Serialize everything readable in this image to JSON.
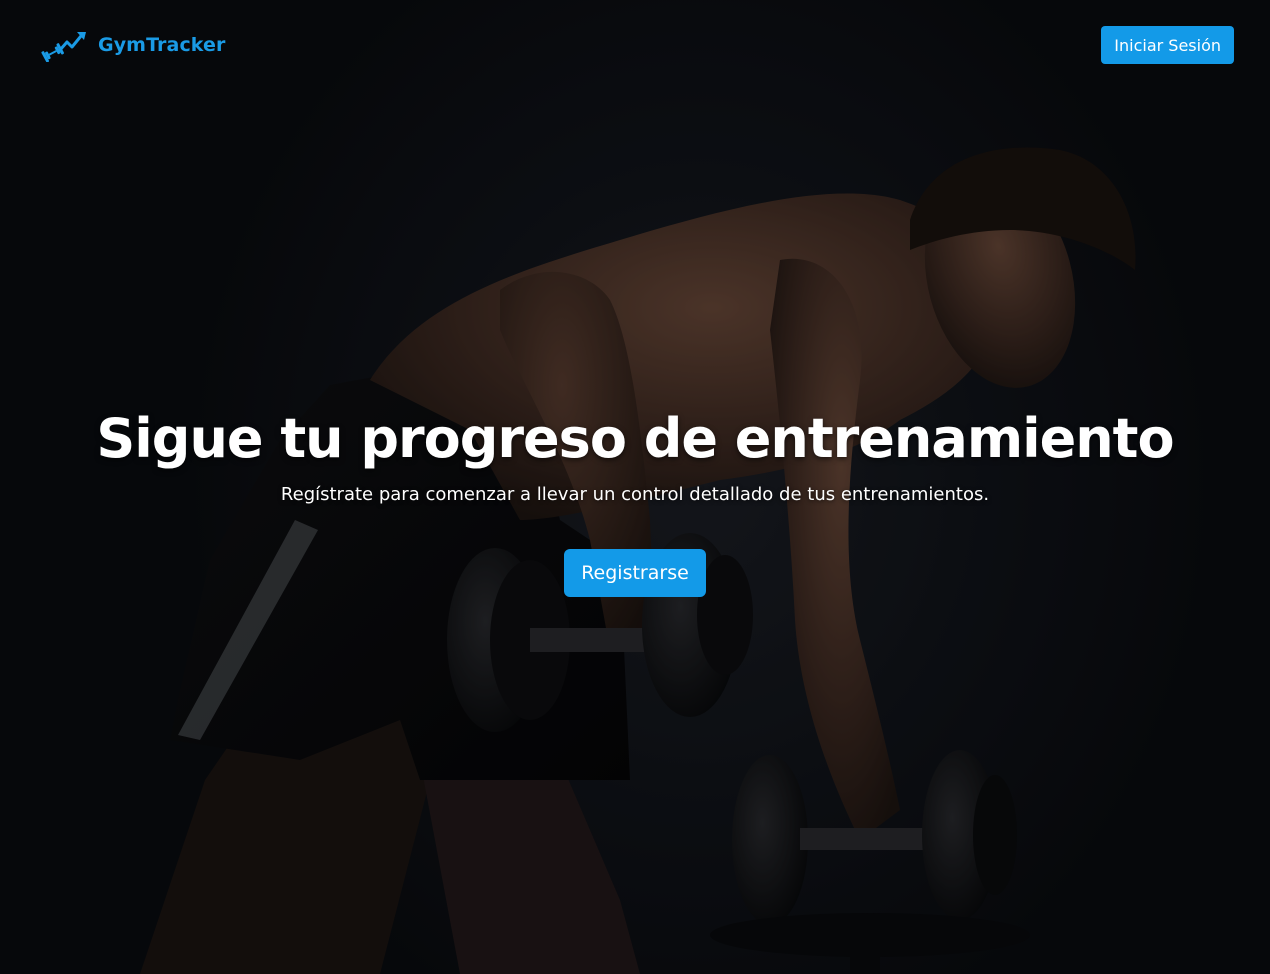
{
  "brand": {
    "name": "GymTracker",
    "icon": "dumbbell-trend-icon",
    "color": "#1a9be6"
  },
  "nav": {
    "login_label": "Iniciar Sesión"
  },
  "hero": {
    "title": "Sigue tu progreso de entrenamiento",
    "subtitle": "Regístrate para comenzar a llevar un control detallado de tus entrenamientos.",
    "register_label": "Registrarse",
    "background_image": "man-lifting-dumbbells-photo"
  },
  "colors": {
    "accent": "#139ae8",
    "background": "#0b0d12",
    "text": "#ffffff"
  }
}
